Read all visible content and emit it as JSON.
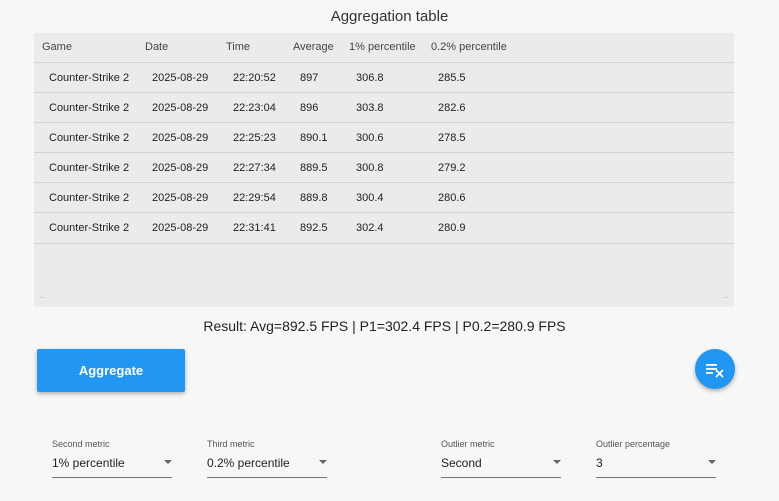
{
  "title": "Aggregation table",
  "table": {
    "headers": [
      "Game",
      "Date",
      "Time",
      "Average",
      "1% percentile",
      "0.2% percentile"
    ],
    "rows": [
      [
        "Counter-Strike 2",
        "2025-08-29",
        "22:20:52",
        "897",
        "306.8",
        "285.5"
      ],
      [
        "Counter-Strike 2",
        "2025-08-29",
        "22:23:04",
        "896",
        "303.8",
        "282.6"
      ],
      [
        "Counter-Strike 2",
        "2025-08-29",
        "22:25:23",
        "890.1",
        "300.6",
        "278.5"
      ],
      [
        "Counter-Strike 2",
        "2025-08-29",
        "22:27:34",
        "889.5",
        "300.8",
        "279.2"
      ],
      [
        "Counter-Strike 2",
        "2025-08-29",
        "22:29:54",
        "889.8",
        "300.4",
        "280.6"
      ],
      [
        "Counter-Strike 2",
        "2025-08-29",
        "22:31:41",
        "892.5",
        "302.4",
        "280.9"
      ]
    ]
  },
  "result": "Result: Avg=892.5 FPS | P1=302.4 FPS | P0.2=280.9 FPS",
  "aggregate_label": "Aggregate",
  "clear_icon": "clear-list-icon",
  "scroll_left_icon": "arrow-left-icon",
  "scroll_right_icon": "arrow-right-icon",
  "fields": {
    "second_metric": {
      "label": "Second metric",
      "value": "1% percentile"
    },
    "third_metric": {
      "label": "Third metric",
      "value": "0.2% percentile"
    },
    "outlier_metric": {
      "label": "Outlier metric",
      "value": "Second"
    },
    "outlier_percentage": {
      "label": "Outlier percentage",
      "value": "3"
    }
  },
  "colors": {
    "accent": "#2196f3",
    "table_bg": "#ebebeb",
    "page_bg": "#f7f7f7"
  }
}
